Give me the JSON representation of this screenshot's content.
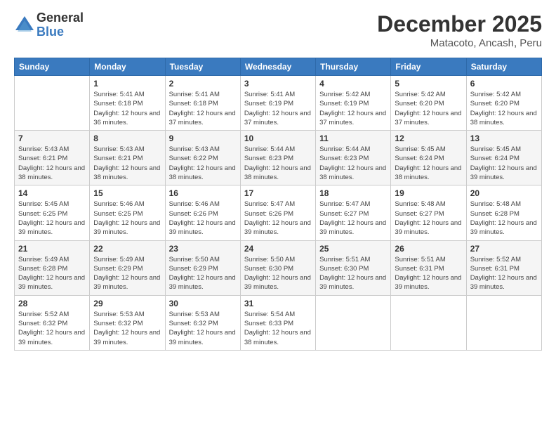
{
  "header": {
    "logo_general": "General",
    "logo_blue": "Blue",
    "title": "December 2025",
    "location": "Matacoto, Ancash, Peru"
  },
  "weekdays": [
    "Sunday",
    "Monday",
    "Tuesday",
    "Wednesday",
    "Thursday",
    "Friday",
    "Saturday"
  ],
  "weeks": [
    [
      {
        "day": "",
        "sunrise": "",
        "sunset": "",
        "daylight": ""
      },
      {
        "day": "1",
        "sunrise": "Sunrise: 5:41 AM",
        "sunset": "Sunset: 6:18 PM",
        "daylight": "Daylight: 12 hours and 36 minutes."
      },
      {
        "day": "2",
        "sunrise": "Sunrise: 5:41 AM",
        "sunset": "Sunset: 6:18 PM",
        "daylight": "Daylight: 12 hours and 37 minutes."
      },
      {
        "day": "3",
        "sunrise": "Sunrise: 5:41 AM",
        "sunset": "Sunset: 6:19 PM",
        "daylight": "Daylight: 12 hours and 37 minutes."
      },
      {
        "day": "4",
        "sunrise": "Sunrise: 5:42 AM",
        "sunset": "Sunset: 6:19 PM",
        "daylight": "Daylight: 12 hours and 37 minutes."
      },
      {
        "day": "5",
        "sunrise": "Sunrise: 5:42 AM",
        "sunset": "Sunset: 6:20 PM",
        "daylight": "Daylight: 12 hours and 37 minutes."
      },
      {
        "day": "6",
        "sunrise": "Sunrise: 5:42 AM",
        "sunset": "Sunset: 6:20 PM",
        "daylight": "Daylight: 12 hours and 38 minutes."
      }
    ],
    [
      {
        "day": "7",
        "sunrise": "Sunrise: 5:43 AM",
        "sunset": "Sunset: 6:21 PM",
        "daylight": "Daylight: 12 hours and 38 minutes."
      },
      {
        "day": "8",
        "sunrise": "Sunrise: 5:43 AM",
        "sunset": "Sunset: 6:21 PM",
        "daylight": "Daylight: 12 hours and 38 minutes."
      },
      {
        "day": "9",
        "sunrise": "Sunrise: 5:43 AM",
        "sunset": "Sunset: 6:22 PM",
        "daylight": "Daylight: 12 hours and 38 minutes."
      },
      {
        "day": "10",
        "sunrise": "Sunrise: 5:44 AM",
        "sunset": "Sunset: 6:23 PM",
        "daylight": "Daylight: 12 hours and 38 minutes."
      },
      {
        "day": "11",
        "sunrise": "Sunrise: 5:44 AM",
        "sunset": "Sunset: 6:23 PM",
        "daylight": "Daylight: 12 hours and 38 minutes."
      },
      {
        "day": "12",
        "sunrise": "Sunrise: 5:45 AM",
        "sunset": "Sunset: 6:24 PM",
        "daylight": "Daylight: 12 hours and 38 minutes."
      },
      {
        "day": "13",
        "sunrise": "Sunrise: 5:45 AM",
        "sunset": "Sunset: 6:24 PM",
        "daylight": "Daylight: 12 hours and 39 minutes."
      }
    ],
    [
      {
        "day": "14",
        "sunrise": "Sunrise: 5:45 AM",
        "sunset": "Sunset: 6:25 PM",
        "daylight": "Daylight: 12 hours and 39 minutes."
      },
      {
        "day": "15",
        "sunrise": "Sunrise: 5:46 AM",
        "sunset": "Sunset: 6:25 PM",
        "daylight": "Daylight: 12 hours and 39 minutes."
      },
      {
        "day": "16",
        "sunrise": "Sunrise: 5:46 AM",
        "sunset": "Sunset: 6:26 PM",
        "daylight": "Daylight: 12 hours and 39 minutes."
      },
      {
        "day": "17",
        "sunrise": "Sunrise: 5:47 AM",
        "sunset": "Sunset: 6:26 PM",
        "daylight": "Daylight: 12 hours and 39 minutes."
      },
      {
        "day": "18",
        "sunrise": "Sunrise: 5:47 AM",
        "sunset": "Sunset: 6:27 PM",
        "daylight": "Daylight: 12 hours and 39 minutes."
      },
      {
        "day": "19",
        "sunrise": "Sunrise: 5:48 AM",
        "sunset": "Sunset: 6:27 PM",
        "daylight": "Daylight: 12 hours and 39 minutes."
      },
      {
        "day": "20",
        "sunrise": "Sunrise: 5:48 AM",
        "sunset": "Sunset: 6:28 PM",
        "daylight": "Daylight: 12 hours and 39 minutes."
      }
    ],
    [
      {
        "day": "21",
        "sunrise": "Sunrise: 5:49 AM",
        "sunset": "Sunset: 6:28 PM",
        "daylight": "Daylight: 12 hours and 39 minutes."
      },
      {
        "day": "22",
        "sunrise": "Sunrise: 5:49 AM",
        "sunset": "Sunset: 6:29 PM",
        "daylight": "Daylight: 12 hours and 39 minutes."
      },
      {
        "day": "23",
        "sunrise": "Sunrise: 5:50 AM",
        "sunset": "Sunset: 6:29 PM",
        "daylight": "Daylight: 12 hours and 39 minutes."
      },
      {
        "day": "24",
        "sunrise": "Sunrise: 5:50 AM",
        "sunset": "Sunset: 6:30 PM",
        "daylight": "Daylight: 12 hours and 39 minutes."
      },
      {
        "day": "25",
        "sunrise": "Sunrise: 5:51 AM",
        "sunset": "Sunset: 6:30 PM",
        "daylight": "Daylight: 12 hours and 39 minutes."
      },
      {
        "day": "26",
        "sunrise": "Sunrise: 5:51 AM",
        "sunset": "Sunset: 6:31 PM",
        "daylight": "Daylight: 12 hours and 39 minutes."
      },
      {
        "day": "27",
        "sunrise": "Sunrise: 5:52 AM",
        "sunset": "Sunset: 6:31 PM",
        "daylight": "Daylight: 12 hours and 39 minutes."
      }
    ],
    [
      {
        "day": "28",
        "sunrise": "Sunrise: 5:52 AM",
        "sunset": "Sunset: 6:32 PM",
        "daylight": "Daylight: 12 hours and 39 minutes."
      },
      {
        "day": "29",
        "sunrise": "Sunrise: 5:53 AM",
        "sunset": "Sunset: 6:32 PM",
        "daylight": "Daylight: 12 hours and 39 minutes."
      },
      {
        "day": "30",
        "sunrise": "Sunrise: 5:53 AM",
        "sunset": "Sunset: 6:32 PM",
        "daylight": "Daylight: 12 hours and 39 minutes."
      },
      {
        "day": "31",
        "sunrise": "Sunrise: 5:54 AM",
        "sunset": "Sunset: 6:33 PM",
        "daylight": "Daylight: 12 hours and 38 minutes."
      },
      {
        "day": "",
        "sunrise": "",
        "sunset": "",
        "daylight": ""
      },
      {
        "day": "",
        "sunrise": "",
        "sunset": "",
        "daylight": ""
      },
      {
        "day": "",
        "sunrise": "",
        "sunset": "",
        "daylight": ""
      }
    ]
  ]
}
